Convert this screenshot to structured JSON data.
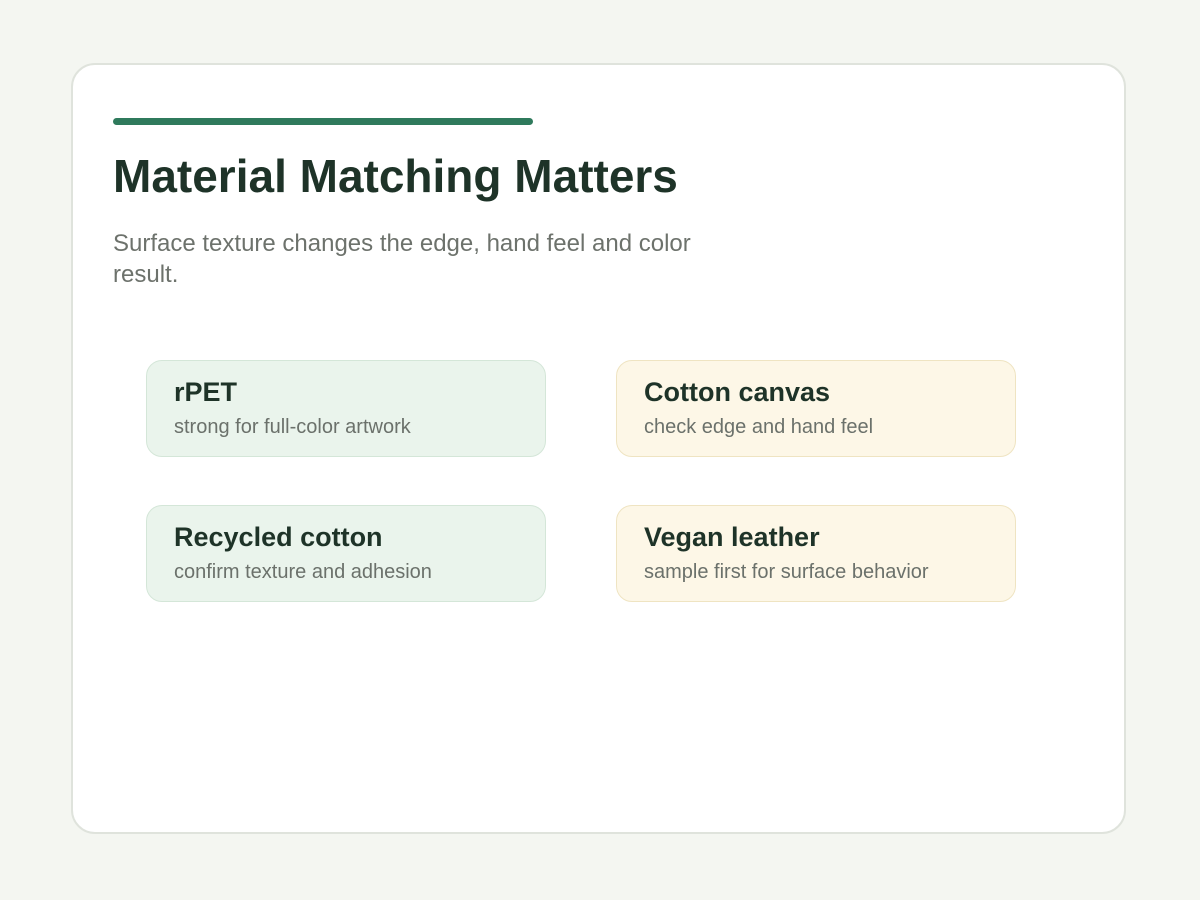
{
  "slide": {
    "title": "Material Matching Matters",
    "subtitle": "Surface texture changes the edge, hand feel and color result.",
    "accent_color": "#2f7a5c"
  },
  "materials": [
    {
      "name": "rPET",
      "note": "strong for full-color artwork",
      "tone": "green",
      "color": "#eaf4ec"
    },
    {
      "name": "Cotton canvas",
      "note": "check edge and hand feel",
      "tone": "cream",
      "color": "#fdf7e7"
    },
    {
      "name": "Recycled cotton",
      "note": "confirm texture and adhesion",
      "tone": "green",
      "color": "#eaf4ec"
    },
    {
      "name": "Vegan leather",
      "note": "sample first for surface behavior",
      "tone": "cream",
      "color": "#fdf7e7"
    }
  ]
}
